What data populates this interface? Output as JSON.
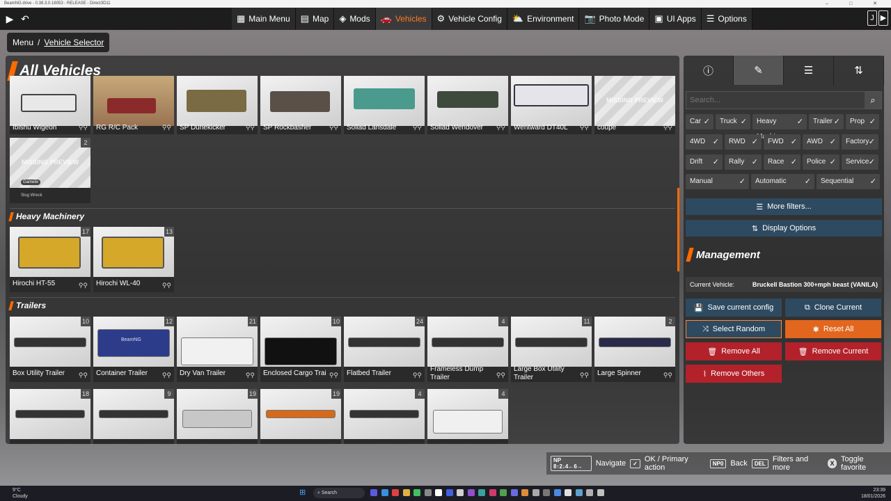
{
  "window": {
    "title": "BeamNG.drive - 0.38.3.0.18053 - RELEASE - Direct3D11",
    "controls": "–  □  ✕"
  },
  "topbar": {
    "tabs": [
      {
        "label": "Main Menu",
        "icon": "▦",
        "name": "tab-main-menu"
      },
      {
        "label": "Map",
        "icon": "▤",
        "name": "tab-map"
      },
      {
        "label": "Mods",
        "icon": "◈",
        "name": "tab-mods"
      },
      {
        "label": "Vehicles",
        "icon": "🚗",
        "name": "tab-vehicles",
        "active": true
      },
      {
        "label": "Vehicle Config",
        "icon": "⚙",
        "name": "tab-vehicle-config"
      },
      {
        "label": "Environment",
        "icon": "⛅",
        "name": "tab-environment"
      },
      {
        "label": "Photo Mode",
        "icon": "📷",
        "name": "tab-photo-mode"
      },
      {
        "label": "UI Apps",
        "icon": "▣",
        "name": "tab-ui-apps"
      },
      {
        "label": "Options",
        "icon": "☰",
        "name": "tab-options"
      }
    ]
  },
  "breadcrumb": {
    "root": "Menu",
    "sep": "/",
    "current": "Vehicle Selector"
  },
  "left": {
    "title": "All Vehicles",
    "sections": {
      "heavy": "Heavy Machinery",
      "trailers": "Trailers"
    },
    "missing": "MISSING PREVIEW",
    "row1": [
      {
        "label": "Ibishu Wigeon"
      },
      {
        "label": "RG R/C Pack"
      },
      {
        "label": "SP Dunekicker"
      },
      {
        "label": "SP Rockbasher"
      },
      {
        "label": "Soliad Lansdale"
      },
      {
        "label": "Soliad Wendover"
      },
      {
        "label": "Wentward DT40L"
      },
      {
        "label": "coupe"
      }
    ],
    "extra": {
      "badge": "2",
      "author1": "Gamelix",
      "author2": "Slug Wreck"
    },
    "heavy": [
      {
        "label": "Hirochi HT-55",
        "badge": "17"
      },
      {
        "label": "Hirochi WL-40",
        "badge": "13"
      }
    ],
    "trailers": [
      {
        "label": "Box Utility Trailer",
        "badge": "10"
      },
      {
        "label": "Container Trailer",
        "badge": "12",
        "brand": "BeamNG"
      },
      {
        "label": "Dry Van Trailer",
        "badge": "21"
      },
      {
        "label": "Enclosed Cargo Trailer",
        "badge": "10"
      },
      {
        "label": "Flatbed Trailer",
        "badge": "24"
      },
      {
        "label": "Frameless Dump Trailer",
        "badge": "4"
      },
      {
        "label": "Large Box Utility Trailer",
        "badge": "11"
      },
      {
        "label": "Large Spinner",
        "badge": "2"
      }
    ],
    "row4": [
      {
        "badge": "18"
      },
      {
        "badge": "9"
      },
      {
        "badge": "19"
      },
      {
        "badge": "19"
      },
      {
        "badge": "4"
      },
      {
        "badge": "4"
      }
    ]
  },
  "right": {
    "search_placeholder": "Search...",
    "chips": [
      [
        "Car",
        "Truck",
        "Heavy Machinery",
        "Trailer",
        "Prop"
      ],
      [
        "4WD",
        "RWD",
        "FWD",
        "AWD",
        "Factory"
      ],
      [
        "Drift",
        "Rally",
        "Race",
        "Police",
        "Service"
      ],
      [
        "Manual",
        "Automatic",
        "Sequential"
      ]
    ],
    "check": "✓",
    "more_filters": "More filters...",
    "display_options": "Display Options",
    "management": "Management",
    "current_vehicle_label": "Current Vehicle:",
    "current_vehicle_value": "Bruckell Bastion 300+mph beast (VANILA)",
    "buttons": {
      "save": "Save current config",
      "clone": "Clone Current",
      "random": "Select Random",
      "reset": "Reset All",
      "remove_all": "Remove All",
      "remove_current": "Remove Current",
      "remove_others": "Remove Others"
    }
  },
  "hints": {
    "nav_key": "NP 8↑2↓4←6→",
    "nav": "Navigate",
    "ok": "OK / Primary action",
    "back_key": "NP0",
    "back": "Back",
    "del_key": "DEL",
    "filters": "Filters and more",
    "x_key": "X",
    "fav": "Toggle favorite"
  },
  "taskbar": {
    "temp": "9°C",
    "weather": "Cloudy",
    "search": "Search",
    "time": "23:39",
    "date": "18/01/2026"
  },
  "colors": {
    "accent": "#ff6a00",
    "button_blue": "#2e4a60",
    "button_red": "#b3222a",
    "button_orange": "#e2661e"
  }
}
